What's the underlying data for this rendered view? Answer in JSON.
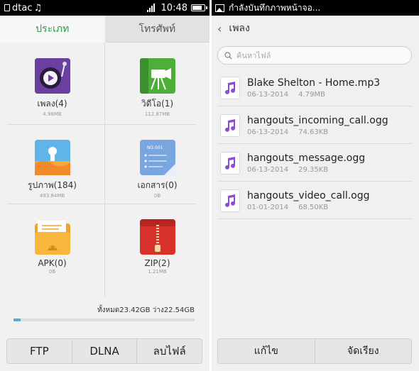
{
  "left": {
    "status": {
      "carrier": "dtac",
      "time": "10:48"
    },
    "tabs": [
      {
        "label": "ประเภท",
        "active": true
      },
      {
        "label": "โทรศัพท์",
        "active": false
      }
    ],
    "categories": [
      {
        "label": "เพลง(4)",
        "size": "4.96MB",
        "icon": "music-disc-icon"
      },
      {
        "label": "วิดีโอ(1)",
        "size": "112.87MB",
        "icon": "video-camera-icon"
      },
      {
        "label": "รูปภาพ(184)",
        "size": "493.84MB",
        "icon": "picture-icon"
      },
      {
        "label": "เอกสาร(0)",
        "size": "0B",
        "icon": "document-icon"
      },
      {
        "label": "APK(0)",
        "size": "0B",
        "icon": "apk-folder-icon"
      },
      {
        "label": "ZIP(2)",
        "size": "1.21MB",
        "icon": "zip-icon"
      }
    ],
    "storage": {
      "text": "ทั้งหมด23.42GB  ว่าง22.54GB",
      "used_fraction": 0.038
    },
    "buttons": [
      "FTP",
      "DLNA",
      "ลบไฟล์"
    ]
  },
  "right": {
    "status": {
      "notification": "กำลังบันทึกภาพหน้าจอ..."
    },
    "header": {
      "title": "เพลง"
    },
    "search": {
      "placeholder": "ค้นหาไฟล์"
    },
    "files": [
      {
        "name": "Blake Shelton - Home.mp3",
        "date": "06-13-2014",
        "size": "4.79MB"
      },
      {
        "name": "hangouts_incoming_call.ogg",
        "date": "06-13-2014",
        "size": "74.63KB"
      },
      {
        "name": "hangouts_message.ogg",
        "date": "06-13-2014",
        "size": "29.35KB"
      },
      {
        "name": "hangouts_video_call.ogg",
        "date": "01-01-2014",
        "size": "68.50KB"
      }
    ],
    "buttons": [
      "แก้ไข",
      "จัดเรียง"
    ]
  },
  "colors": {
    "accent": "#2f9a4a",
    "storage_bar": "#5aa9d9",
    "music_note": "#8e4bd6"
  }
}
